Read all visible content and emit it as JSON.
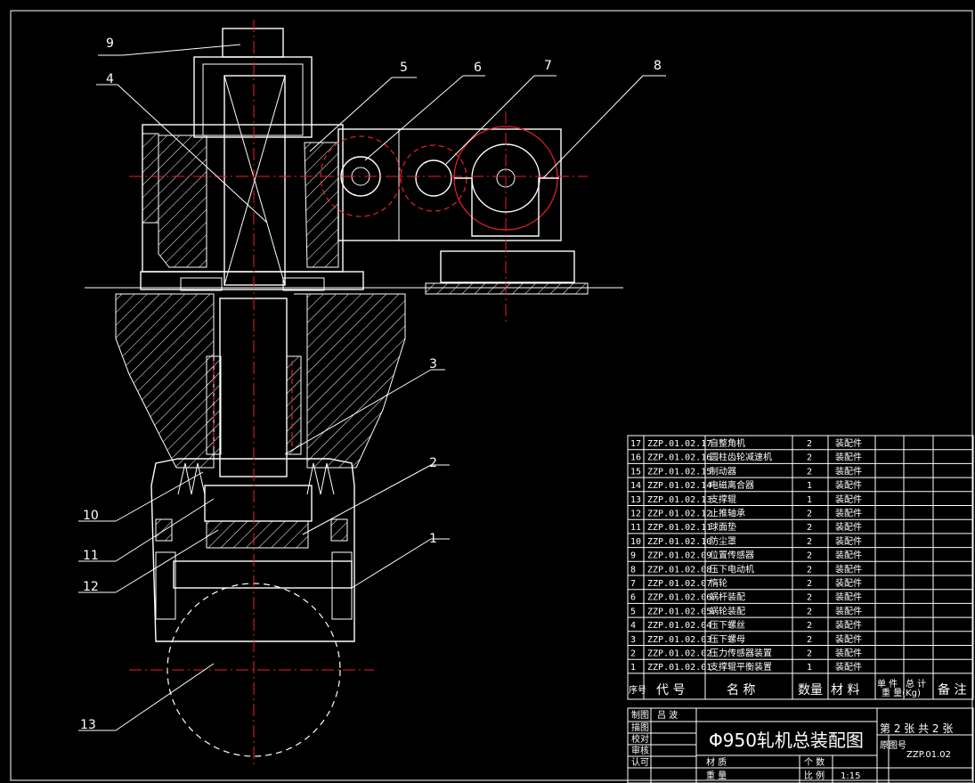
{
  "balloons": [
    "1",
    "2",
    "3",
    "4",
    "5",
    "6",
    "7",
    "8",
    "9",
    "10",
    "11",
    "12",
    "13"
  ],
  "parts_list": [
    {
      "no": "17",
      "code": "ZZP.01.02.17",
      "name": "自整角机",
      "qty": "2",
      "material": "装配件"
    },
    {
      "no": "16",
      "code": "ZZP.01.02.16",
      "name": "圆柱齿轮减速机",
      "qty": "2",
      "material": "装配件"
    },
    {
      "no": "15",
      "code": "ZZP.01.02.15",
      "name": "制动器",
      "qty": "2",
      "material": "装配件"
    },
    {
      "no": "14",
      "code": "ZZP.01.02.14",
      "name": "电磁离合器",
      "qty": "1",
      "material": "装配件"
    },
    {
      "no": "13",
      "code": "ZZP.01.02.13",
      "name": "支撑辊",
      "qty": "1",
      "material": "装配件"
    },
    {
      "no": "12",
      "code": "ZZP.01.02.12",
      "name": "止推轴承",
      "qty": "2",
      "material": "装配件"
    },
    {
      "no": "11",
      "code": "ZZP.01.02.11",
      "name": "球面垫",
      "qty": "2",
      "material": "装配件"
    },
    {
      "no": "10",
      "code": "ZZP.01.02.10",
      "name": "防尘罩",
      "qty": "2",
      "material": "装配件"
    },
    {
      "no": "9",
      "code": "ZZP.01.02.09",
      "name": "位置传感器",
      "qty": "2",
      "material": "装配件"
    },
    {
      "no": "8",
      "code": "ZZP.01.02.08",
      "name": "压下电动机",
      "qty": "2",
      "material": "装配件"
    },
    {
      "no": "7",
      "code": "ZZP.01.02.07",
      "name": "惰轮",
      "qty": "2",
      "material": "装配件"
    },
    {
      "no": "6",
      "code": "ZZP.01.02.06",
      "name": "蜗杆装配",
      "qty": "2",
      "material": "装配件"
    },
    {
      "no": "5",
      "code": "ZZP.01.02.05",
      "name": "蜗轮装配",
      "qty": "2",
      "material": "装配件"
    },
    {
      "no": "4",
      "code": "ZZP.01.02.04",
      "name": "压下螺丝",
      "qty": "2",
      "material": "装配件"
    },
    {
      "no": "3",
      "code": "ZZP.01.02.03",
      "name": "压下螺母",
      "qty": "2",
      "material": "装配件"
    },
    {
      "no": "2",
      "code": "ZZP.01.02.02",
      "name": "压力传感器装置",
      "qty": "2",
      "material": "装配件"
    },
    {
      "no": "1",
      "code": "ZZP.01.02.01",
      "name": "支撑辊平衡装置",
      "qty": "1",
      "material": "装配件"
    }
  ],
  "header": {
    "no": "序号",
    "code": "代    号",
    "name": "名    称",
    "qty": "数量",
    "material": "材  料",
    "single": "单 件",
    "total": "总 计",
    "weight": "重 量(Kg)",
    "remark": "备 注"
  },
  "title_block": {
    "title": "Φ950轧机总装配图",
    "drawn": "制图",
    "drawn_by": "吕 波",
    "traced": "描图",
    "checked": "校对",
    "reviewed": "审核",
    "approved": "认可",
    "material_label": "材 质",
    "weight_label": "重 量",
    "count_label": "个 数",
    "scale_label": "比 例",
    "scale": "1:15",
    "sheet_text": "第 2 张 共 2 张",
    "drawing_no_label": "原图号",
    "drawing_no": "ZZP.01.02"
  }
}
